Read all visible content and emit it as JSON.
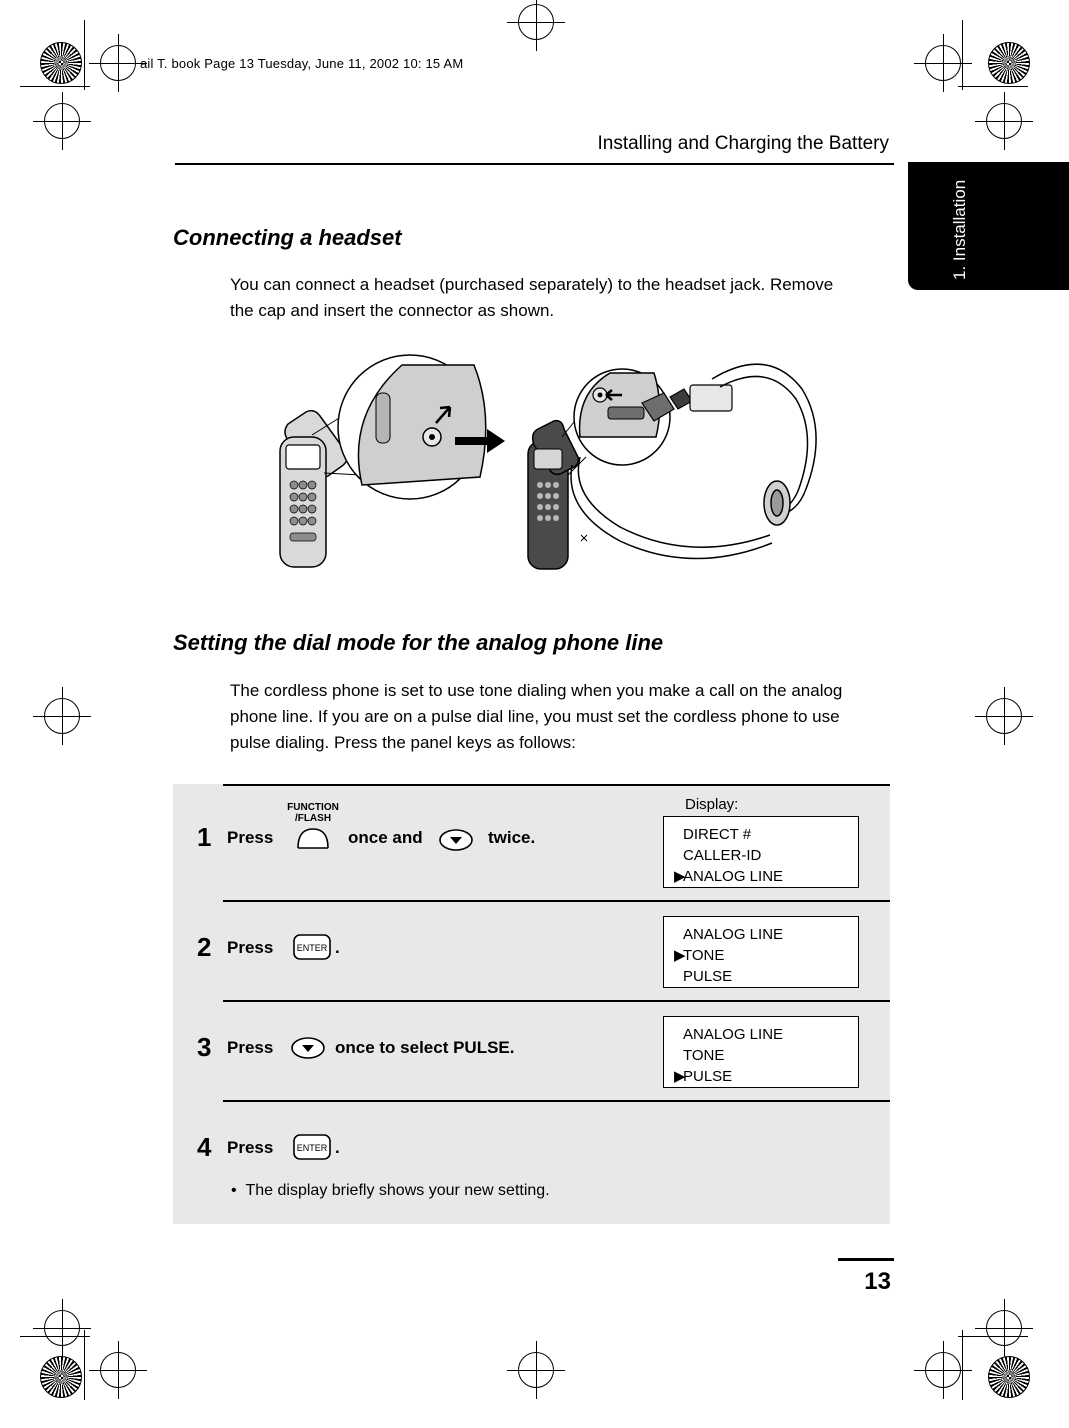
{
  "header": {
    "filename": "ail T. book  Page  13    Tuesday,   June  11,   2002    10: 15  AM",
    "running_head": "Installing and Charging the Battery",
    "tab_label": "1. Installation"
  },
  "sections": [
    {
      "heading": "Connecting a headset",
      "body": "You can connect a headset (purchased separately) to the headset jack. Remove the cap and insert the connector as shown."
    },
    {
      "heading": "Setting the dial mode for the analog phone line",
      "body": "The cordless phone is set to use tone dialing when you make a call on the analog phone line. If you are on a pulse dial line, you must set the cordless phone to use pulse dialing. Press the panel keys as follows:"
    }
  ],
  "display_label": "Display:",
  "keys": {
    "function_flash_line1": "FUNCTION",
    "function_flash_line2": "/FLASH",
    "enter_label": "ENTER"
  },
  "steps": [
    {
      "number": "1",
      "text_before": "Press",
      "text_middle": "once and",
      "text_after": "twice.",
      "lcd": [
        "DIRECT #",
        "CALLER-ID",
        "ANALOG LINE"
      ],
      "lcd_selected_index": 2
    },
    {
      "number": "2",
      "text_before": "Press",
      "text_after": ".",
      "lcd": [
        "ANALOG LINE",
        "TONE",
        "PULSE"
      ],
      "lcd_selected_index": 1
    },
    {
      "number": "3",
      "text_before": "Press",
      "text_after": "once to select PULSE.",
      "lcd": [
        "ANALOG LINE",
        "TONE",
        "PULSE"
      ],
      "lcd_selected_index": 2
    },
    {
      "number": "4",
      "text_before": "Press",
      "text_after": ".",
      "bullet": "The display briefly shows your new setting."
    }
  ],
  "page_number": "13"
}
